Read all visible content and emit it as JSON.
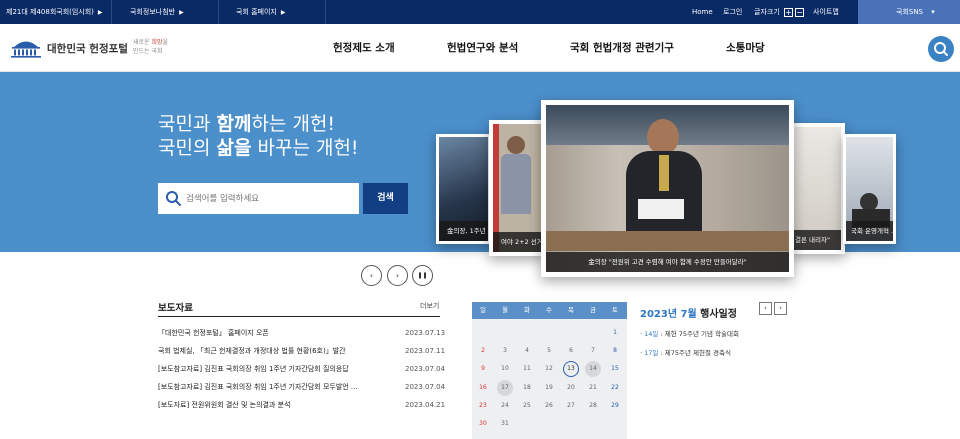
{
  "topbar": {
    "links": [
      {
        "label": "제21대 제408회국회(임시회)",
        "arrow": "▶"
      },
      {
        "label": "국회정보나침반",
        "arrow": "▶"
      },
      {
        "label": "국회 홈페이지",
        "arrow": "▶"
      }
    ],
    "right": {
      "home": "Home",
      "login": "로그인",
      "font_size": "글자크기",
      "font_plus": "+",
      "font_minus": "−",
      "sitemap": "사이트맵",
      "sns": "국회SNS",
      "sns_arrow": "▾"
    }
  },
  "header": {
    "logo_text": "대한민국 헌정포털",
    "slogan": {
      "line1_pre": "새로운 ",
      "line1_highlight": "희망",
      "line1_post": "을",
      "line2": "만드는 국회"
    },
    "nav": [
      "헌정제도 소개",
      "헌법연구와 분석",
      "국회 헌법개정 관련기구",
      "소통마당"
    ]
  },
  "hero": {
    "line1_pre": "국민과 ",
    "line1_bold": "함께",
    "line1_post": "하는 개헌!",
    "line2_pre": "국민의 ",
    "line2_bold": "삶을",
    "line2_post": " 바꾸는 개헌!",
    "search_placeholder": "검색어를 입력하세요",
    "search_button": "검색"
  },
  "slides": {
    "far_left_caption": "金의장, 1주년",
    "left_caption": "여야 2+2 선거",
    "center_caption": "金의장 \"전원위 고견 수렴해 여야 함께 수정안 만들어달라\"",
    "right_caption": "결론 내리자\"",
    "far_right_caption": "국회 운영개혁 ..."
  },
  "slider_controls": {
    "prev": "‹",
    "next": "›",
    "pause": "❚❚"
  },
  "press": {
    "title": "보도자료",
    "more": "더보기",
    "items": [
      {
        "title": "「대한민국 헌정포털」 홈페이지 오픈",
        "date": "2023.07.13"
      },
      {
        "title": "국회 법제실, 「최근 헌재결정과 개정대상 법률 현황(6호)」발간",
        "date": "2023.07.11"
      },
      {
        "title": "[보도참고자료] 김진표 국회의장 취임 1주년 기자간담회 질의응답",
        "date": "2023.07.04"
      },
      {
        "title": "[보도참고자료] 김진표 국회의장 취임 1주년 기자간담회 모두발언 ...",
        "date": "2023.07.04"
      },
      {
        "title": "[보도자료] 전원위원회 결산 및 논의결과 분석",
        "date": "2023.04.21"
      }
    ]
  },
  "calendar": {
    "weekdays": [
      "일",
      "월",
      "화",
      "수",
      "목",
      "금",
      "토"
    ],
    "weeks": [
      [
        "",
        "",
        "",
        "",
        "",
        "",
        "1"
      ],
      [
        "2",
        "3",
        "4",
        "5",
        "6",
        "7",
        "8"
      ],
      [
        "9",
        "10",
        "11",
        "12",
        "13",
        "14",
        "15"
      ],
      [
        "16",
        "17",
        "18",
        "19",
        "20",
        "21",
        "22"
      ],
      [
        "23",
        "24",
        "25",
        "26",
        "27",
        "28",
        "29"
      ],
      [
        "30",
        "31",
        "",
        "",
        "",
        "",
        ""
      ]
    ],
    "today": "13",
    "event_days": [
      "14",
      "17"
    ]
  },
  "events": {
    "year_month": "2023년 7월",
    "title_suffix": " 행사일정",
    "prev": "‹",
    "next": "›",
    "items": [
      {
        "date": "14일",
        "text": " : 제헌 75주년 기념 학술대회"
      },
      {
        "date": "17일",
        "text": " : 제75주년 제헌절 경축식"
      }
    ]
  },
  "colors": {
    "topbar": "#0a2a66",
    "hero": "#4b8fcb",
    "accent": "#2f78c4",
    "search_button": "#123f84",
    "sns": "#4a72b8"
  }
}
